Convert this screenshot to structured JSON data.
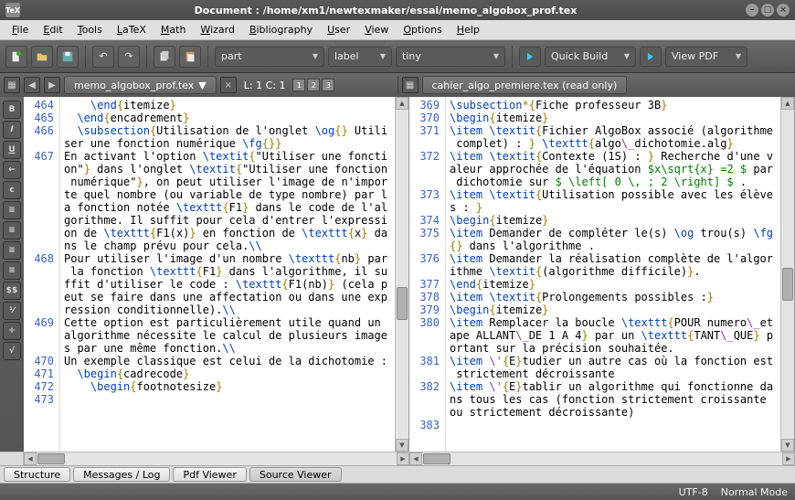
{
  "title": "Document : /home/xm1/newtexmaker/essai/memo_algobox_prof.tex",
  "menu": [
    "File",
    "Edit",
    "Tools",
    "LaTeX",
    "Math",
    "Wizard",
    "Bibliography",
    "User",
    "View",
    "Options",
    "Help"
  ],
  "combo": {
    "section": "part",
    "label": "label",
    "size": "tiny"
  },
  "run": {
    "quickbuild": "Quick Build",
    "viewpdf": "View PDF"
  },
  "left_tab": "memo_algobox_prof.tex",
  "right_tab": "cahier_algo_premiere.tex (read only)",
  "cursor_status": "L: 1 C: 1",
  "panes": [
    "1",
    "2",
    "3"
  ],
  "bottom_tabs": [
    "Structure",
    "Messages / Log",
    "Pdf Viewer",
    "Source Viewer"
  ],
  "bottom_active": 3,
  "status": {
    "encoding": "UTF-8",
    "mode": "Normal Mode"
  },
  "left_lines": [
    {
      "n": 464,
      "cont": false,
      "seg": [
        [
          "    ",
          ""
        ],
        [
          "\\end",
          "kw"
        ],
        [
          "{",
          "br"
        ],
        [
          "itemize",
          ""
        ],
        [
          "}",
          "br"
        ]
      ]
    },
    {
      "n": 465,
      "cont": false,
      "seg": [
        [
          "  ",
          ""
        ],
        [
          "\\end",
          "kw"
        ],
        [
          "{",
          "br"
        ],
        [
          "encadrement",
          ""
        ],
        [
          "}",
          "br"
        ]
      ]
    },
    {
      "n": 466,
      "cont": false,
      "seg": [
        [
          "  ",
          ""
        ],
        [
          "\\subsection",
          "kw"
        ],
        [
          "{",
          "br"
        ],
        [
          "Utilisation de l'onglet ",
          ""
        ],
        [
          "\\og",
          "kw"
        ],
        [
          "{}",
          "br"
        ],
        [
          " Utiliser une fonction numérique ",
          ""
        ],
        [
          "\\fg",
          "kw"
        ],
        [
          "{}}",
          "br"
        ]
      ]
    },
    {
      "n": 467,
      "cont": false,
      "seg": [
        [
          "En activant l'option ",
          ""
        ],
        [
          "\\textit",
          "kw"
        ],
        [
          "{",
          "br"
        ],
        [
          "\"Utiliser une fonction\"",
          ""
        ],
        [
          "}",
          "br"
        ],
        [
          " dans l'onglet ",
          ""
        ],
        [
          "\\textit",
          "kw"
        ],
        [
          "{",
          "br"
        ],
        [
          "\"Utiliser une fonction numérique\"",
          ""
        ],
        [
          "}",
          "br"
        ],
        [
          ", on peut utiliser l'image de n'importe quel nombre (ou variable de type nombre) par la fonction notée ",
          ""
        ],
        [
          "\\texttt",
          "kw"
        ],
        [
          "{",
          "br"
        ],
        [
          "F1",
          ""
        ],
        [
          "}",
          "br"
        ],
        [
          " dans le code de l'algorithme. Il suffit pour cela d'entrer l'expression de ",
          ""
        ],
        [
          "\\texttt",
          "kw"
        ],
        [
          "{",
          "br"
        ],
        [
          "F1(x)",
          ""
        ],
        [
          "}",
          "br"
        ],
        [
          " en fonction de ",
          ""
        ],
        [
          "\\texttt",
          "kw"
        ],
        [
          "{",
          "br"
        ],
        [
          "x",
          ""
        ],
        [
          "}",
          "br"
        ],
        [
          " dans le champ prévu pour cela.",
          ""
        ],
        [
          "\\\\",
          "kw"
        ]
      ]
    },
    {
      "n": 468,
      "cont": false,
      "seg": [
        [
          "Pour utiliser l'image d'un nombre ",
          ""
        ],
        [
          "\\texttt",
          "kw"
        ],
        [
          "{",
          "br"
        ],
        [
          "nb",
          ""
        ],
        [
          "}",
          "br"
        ],
        [
          " par la fonction ",
          ""
        ],
        [
          "\\texttt",
          "kw"
        ],
        [
          "{",
          "br"
        ],
        [
          "F1",
          ""
        ],
        [
          "}",
          "br"
        ],
        [
          " dans l'algorithme, il suffit d'utiliser le code : ",
          ""
        ],
        [
          "\\texttt",
          "kw"
        ],
        [
          "{",
          "br"
        ],
        [
          "F1(nb)",
          ""
        ],
        [
          "}",
          "br"
        ],
        [
          " (cela peut se faire dans une affectation ou dans une expression conditionnelle).",
          ""
        ],
        [
          "\\\\",
          "kw"
        ]
      ]
    },
    {
      "n": 469,
      "cont": false,
      "seg": [
        [
          "Cette option est particulièrement utile quand un algorithme nécessite le calcul de plusieurs images par une même fonction.",
          ""
        ],
        [
          "\\\\",
          "kw"
        ]
      ]
    },
    {
      "n": 470,
      "cont": false,
      "seg": [
        [
          "Un exemple classique est celui de la dichotomie :",
          ""
        ]
      ]
    },
    {
      "n": 471,
      "cont": false,
      "seg": [
        [
          "  ",
          ""
        ],
        [
          "\\begin",
          "kw"
        ],
        [
          "{",
          "br"
        ],
        [
          "cadrecode",
          ""
        ],
        [
          "}",
          "br"
        ]
      ]
    },
    {
      "n": 472,
      "cont": false,
      "seg": [
        [
          "    ",
          ""
        ],
        [
          "\\begin",
          "kw"
        ],
        [
          "{",
          "br"
        ],
        [
          "footnotesize",
          ""
        ],
        [
          "}",
          "br"
        ]
      ]
    },
    {
      "n": 473,
      "cont": false,
      "seg": [
        [
          "",
          ""
        ]
      ]
    }
  ],
  "right_lines": [
    {
      "n": 369,
      "cont": false,
      "seg": [
        [
          "\\subsection",
          "kw"
        ],
        [
          "*{",
          "br"
        ],
        [
          "Fiche professeur 3B",
          ""
        ],
        [
          "}",
          "br"
        ]
      ]
    },
    {
      "n": 370,
      "cont": false,
      "seg": [
        [
          "\\begin",
          "kw"
        ],
        [
          "{",
          "br"
        ],
        [
          "itemize",
          ""
        ],
        [
          "}",
          "br"
        ]
      ]
    },
    {
      "n": 371,
      "cont": false,
      "seg": [
        [
          "\\item",
          "kw"
        ],
        [
          " ",
          ""
        ],
        [
          "\\textit",
          "kw"
        ],
        [
          "{",
          "br"
        ],
        [
          "Fichier AlgoBox associé (algorithme complet) : ",
          ""
        ],
        [
          "}",
          "br"
        ],
        [
          " ",
          ""
        ],
        [
          "\\texttt",
          "kw"
        ],
        [
          "{",
          "br"
        ],
        [
          "algo",
          ""
        ],
        [
          "\\_",
          "mf"
        ],
        [
          "dichotomie.alg",
          ""
        ],
        [
          "}",
          "br"
        ]
      ]
    },
    {
      "n": 372,
      "cont": false,
      "seg": [
        [
          "\\item",
          "kw"
        ],
        [
          " ",
          ""
        ],
        [
          "\\textit",
          "kw"
        ],
        [
          "{",
          "br"
        ],
        [
          "Contexte (1S) : ",
          ""
        ],
        [
          "}",
          "br"
        ],
        [
          " Recherche d'une valeur approchée de l'équation ",
          ""
        ],
        [
          "$x\\sqrt{x} =2 $",
          "mt"
        ],
        [
          " par dichotomie sur ",
          ""
        ],
        [
          "$ \\left[ 0 \\, ; 2 \\right] $",
          "mt"
        ],
        [
          " .",
          ""
        ]
      ]
    },
    {
      "n": 373,
      "cont": false,
      "seg": [
        [
          "\\item",
          "kw"
        ],
        [
          " ",
          ""
        ],
        [
          "\\textit",
          "kw"
        ],
        [
          "{",
          "br"
        ],
        [
          "Utilisation possible avec les élèves : ",
          ""
        ],
        [
          "}",
          "br"
        ]
      ]
    },
    {
      "n": 374,
      "cont": false,
      "seg": [
        [
          "\\begin",
          "kw"
        ],
        [
          "{",
          "br"
        ],
        [
          "itemize",
          ""
        ],
        [
          "}",
          "br"
        ]
      ]
    },
    {
      "n": 375,
      "cont": false,
      "seg": [
        [
          "\\item",
          "kw"
        ],
        [
          " Demander de compléter le(s) ",
          ""
        ],
        [
          "\\og",
          "kw"
        ],
        [
          " trou(s) ",
          ""
        ],
        [
          "\\fg",
          "kw"
        ],
        [
          "{}",
          "br"
        ],
        [
          " dans l'algorithme .",
          ""
        ]
      ]
    },
    {
      "n": 376,
      "cont": false,
      "seg": [
        [
          "\\item",
          "kw"
        ],
        [
          " Demander la réalisation complète de l'algorithme ",
          ""
        ],
        [
          "\\textit",
          "kw"
        ],
        [
          "{",
          "br"
        ],
        [
          "(algorithme difficile)",
          ""
        ],
        [
          "}",
          "br"
        ],
        [
          ".",
          ""
        ]
      ]
    },
    {
      "n": 377,
      "cont": false,
      "seg": [
        [
          "\\end",
          "kw"
        ],
        [
          "{",
          "br"
        ],
        [
          "itemize",
          ""
        ],
        [
          "}",
          "br"
        ]
      ]
    },
    {
      "n": 378,
      "cont": false,
      "seg": [
        [
          "\\item",
          "kw"
        ],
        [
          " ",
          ""
        ],
        [
          "\\textit",
          "kw"
        ],
        [
          "{",
          "br"
        ],
        [
          "Prolongements possibles :",
          ""
        ],
        [
          "}",
          "br"
        ]
      ]
    },
    {
      "n": 379,
      "cont": false,
      "seg": [
        [
          "\\begin",
          "kw"
        ],
        [
          "{",
          "br"
        ],
        [
          "itemize",
          ""
        ],
        [
          "}",
          "br"
        ]
      ]
    },
    {
      "n": 380,
      "cont": false,
      "seg": [
        [
          "\\item",
          "kw"
        ],
        [
          " Remplacer la boucle ",
          ""
        ],
        [
          "\\texttt",
          "kw"
        ],
        [
          "{",
          "br"
        ],
        [
          "POUR numero",
          ""
        ],
        [
          "\\_",
          "mf"
        ],
        [
          "etape ALLANT",
          ""
        ],
        [
          "\\_",
          "mf"
        ],
        [
          "DE 1 A 4",
          ""
        ],
        [
          "}",
          "br"
        ],
        [
          " par un ",
          ""
        ],
        [
          "\\texttt",
          "kw"
        ],
        [
          "{",
          "br"
        ],
        [
          "TANT",
          ""
        ],
        [
          "\\_",
          "mf"
        ],
        [
          "QUE",
          ""
        ],
        [
          "}",
          "br"
        ],
        [
          " portant sur la précision souhaitée.",
          ""
        ]
      ]
    },
    {
      "n": 381,
      "cont": false,
      "seg": [
        [
          "\\item",
          "kw"
        ],
        [
          " ",
          ""
        ],
        [
          "\\'",
          "mf"
        ],
        [
          "{",
          "br"
        ],
        [
          "E",
          ""
        ],
        [
          "}",
          "br"
        ],
        [
          "tudier un autre cas où la fonction est strictement décroissante",
          ""
        ]
      ]
    },
    {
      "n": 382,
      "cont": false,
      "seg": [
        [
          "\\item",
          "kw"
        ],
        [
          " ",
          ""
        ],
        [
          "\\'",
          "mf"
        ],
        [
          "{",
          "br"
        ],
        [
          "E",
          ""
        ],
        [
          "}",
          "br"
        ],
        [
          "tablir un algorithme qui fonctionne dans tous les cas (fonction strictement croissante ou strictement décroissante)",
          ""
        ]
      ]
    },
    {
      "n": 383,
      "cont": false,
      "seg": [
        [
          "",
          ""
        ]
      ]
    }
  ],
  "side_buttons": [
    "B",
    "I",
    "U",
    "←",
    "c",
    "≡",
    "≡",
    "≡",
    "≡",
    "$$",
    "⅟",
    "÷",
    "√"
  ]
}
